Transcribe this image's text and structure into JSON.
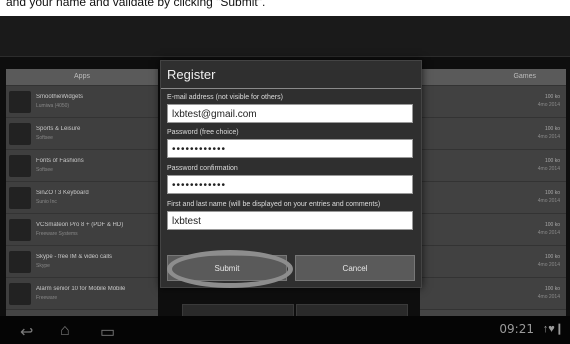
{
  "caption": {
    "text": "and your name and validate by clicking \"Submit\"."
  },
  "left_panel": {
    "header": "Apps",
    "apps": [
      {
        "title": "SmoothieWidgets",
        "sub": "Lumiwa (4050)"
      },
      {
        "title": "Sports & Leisure",
        "sub": "Softsee"
      },
      {
        "title": "Fonts of Fashions",
        "sub": "Softsee"
      },
      {
        "title": "SinZO ! 3 Keyboard",
        "sub": "Sunio Inc"
      },
      {
        "title": "VCSmateon Pro 8 + (PDF & HD)",
        "sub": "Freeware Systems"
      },
      {
        "title": "Skype - free IM & video calls",
        "sub": "Skype"
      },
      {
        "title": "Alarm senior 10 for Mobile Mobile",
        "sub": "Freeware"
      }
    ]
  },
  "right_panel": {
    "header": "Games",
    "rows": [
      {
        "top": "100 ko",
        "bot": "4mo 2014"
      },
      {
        "top": "100 ko",
        "bot": "4mo 2014"
      },
      {
        "top": "100 ko",
        "bot": "4mo 2014"
      },
      {
        "top": "100 ko",
        "bot": "4mo 2014"
      },
      {
        "top": "100 ko",
        "bot": "4mo 2014"
      },
      {
        "top": "100 ko",
        "bot": "4mo 2014"
      },
      {
        "top": "100 ko",
        "bot": "4mo 2014"
      }
    ]
  },
  "dialog": {
    "title": "Register",
    "email_label": "E-mail address (not visible for others)",
    "email_value": "lxbtest@gmail.com",
    "password_label": "Password (free choice)",
    "password_value": "••••••••••••",
    "confirm_label": "Password confirmation",
    "confirm_value": "••••••••••••",
    "name_label": "First and last name (will be displayed on your entries and comments)",
    "name_value": "lxbtest",
    "submit_label": "Submit",
    "cancel_label": "Cancel"
  },
  "system_bar": {
    "back_icon": "↩",
    "home_icon": "⌂",
    "recent_icon": "▭",
    "time": "09:21",
    "status": "↑♥❙"
  }
}
